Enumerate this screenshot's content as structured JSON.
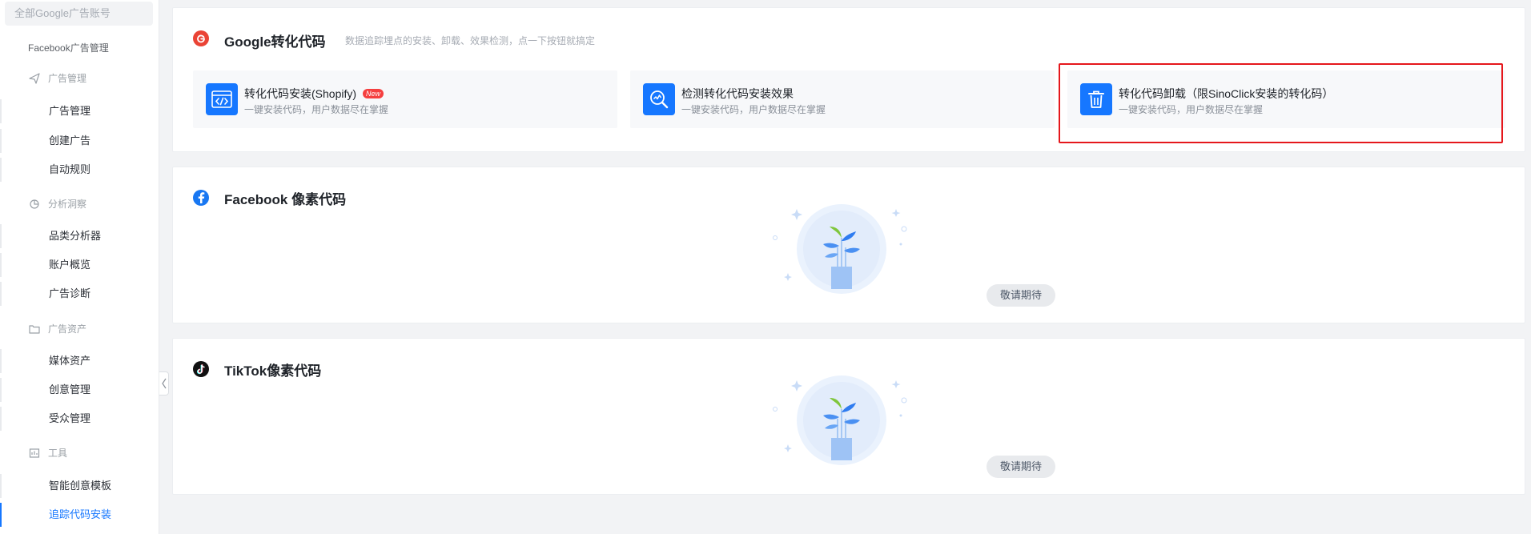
{
  "sidebar": {
    "account_placeholder": "全部Google广告账号",
    "facebook_header": "Facebook广告管理",
    "groups": {
      "ads": {
        "label": "广告管理",
        "icon": "send-icon",
        "items": [
          "广告管理",
          "创建广告",
          "自动规则"
        ]
      },
      "analysis": {
        "label": "分析洞察",
        "icon": "chart-icon",
        "items": [
          "品类分析器",
          "账户概览",
          "广告诊断"
        ]
      },
      "assets": {
        "label": "广告资产",
        "icon": "folder-icon",
        "items": [
          "媒体资产",
          "创意管理",
          "受众管理"
        ]
      },
      "tools": {
        "label": "工具",
        "icon": "tool-icon",
        "items": [
          "智能创意模板",
          "追踪代码安装"
        ],
        "active_item": "追踪代码安装"
      }
    }
  },
  "google": {
    "title": "Google转化代码",
    "subtitle": "数据追踪埋点的安装、卸载、效果检测，点一下按钮就搞定",
    "icon": "google-icon",
    "tools": [
      {
        "name": "转化代码安装(Shopify)",
        "badge": "New",
        "desc": "一键安装代码，用户数据尽在掌握",
        "icon": "code-window-icon"
      },
      {
        "name": "检测转化代码安装效果",
        "desc": "一键安装代码，用户数据尽在掌握",
        "icon": "magnifier-chart-icon"
      },
      {
        "name": "转化代码卸载（限SinoClick安装的转化码）",
        "desc": "一键安装代码，用户数据尽在掌握",
        "icon": "trash-icon"
      }
    ]
  },
  "facebook": {
    "title": "Facebook 像素代码",
    "icon": "facebook-icon",
    "empty_label": "敬请期待"
  },
  "tiktok": {
    "title": "TikTok像素代码",
    "icon": "tiktok-icon",
    "empty_label": "敬请期待"
  },
  "colors": {
    "accent": "#1677ff",
    "google_red": "#ea4335",
    "facebook_blue": "#1877f2",
    "tiktok_black": "#111111",
    "highlight_red": "#e5171c",
    "new_badge": "#f53f3f"
  }
}
